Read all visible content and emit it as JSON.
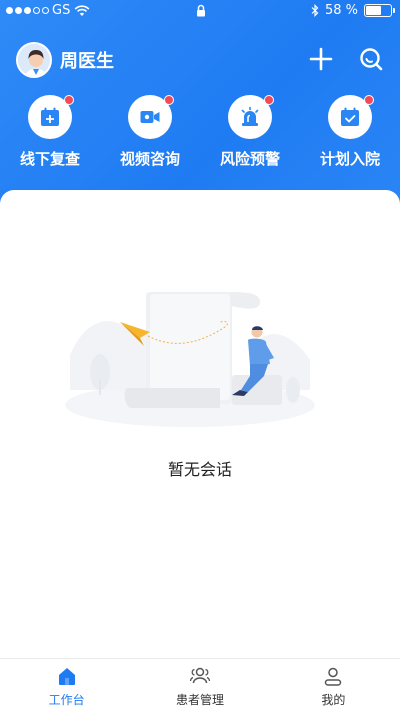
{
  "status": {
    "carrier": "GS",
    "battery": "58 %"
  },
  "header": {
    "doctor_name": "周医生"
  },
  "quick_actions": [
    {
      "label": "线下复查",
      "icon": "calendar-add-icon"
    },
    {
      "label": "视频咨询",
      "icon": "video-icon"
    },
    {
      "label": "风险预警",
      "icon": "alarm-light-icon"
    },
    {
      "label": "计划入院",
      "icon": "calendar-check-icon"
    }
  ],
  "main": {
    "empty_text": "暂无会话"
  },
  "tabs": [
    {
      "label": "工作台",
      "icon": "home-icon",
      "active": true
    },
    {
      "label": "患者管理",
      "icon": "patients-icon",
      "active": false
    },
    {
      "label": "我的",
      "icon": "profile-icon",
      "active": false
    }
  ],
  "colors": {
    "primary": "#1f7bf2",
    "badge": "#f24b57"
  }
}
